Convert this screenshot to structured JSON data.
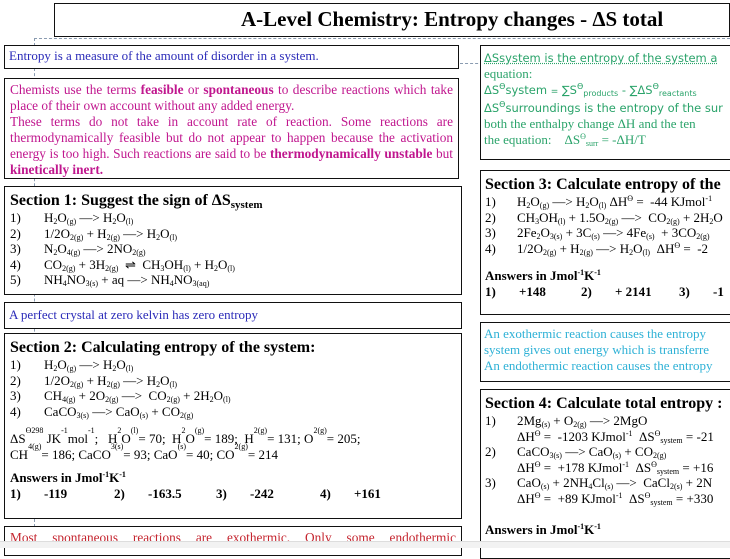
{
  "title": "A-Level Chemistry:  Entropy changes - ΔS total",
  "left": {
    "entropy_def": "Entropy is a measure of the amount of disorder in a system.",
    "feasible": {
      "p1_a": "Chemists use the terms ",
      "p1_b": "feasible",
      "p1_c": " or ",
      "p1_d": "spontaneous",
      "p1_e": " to describe reactions which take place of their own account without any added energy.",
      "p2_a": "These terms do not take in account rate of reaction.  Some reactions are thermodynamically feasible but do not appear to happen because the activation energy is too high.  Such reactions are said to be ",
      "p2_b": "thermodynamically unstable",
      "p2_c": " but ",
      "p2_d": "kinetically inert."
    },
    "section1": {
      "heading": "Section 1: Suggest the sign of ΔS",
      "heading_sub": "system",
      "items": [
        "1)",
        "2)",
        "3)",
        "4)",
        "5)"
      ]
    },
    "perfect_crystal": "A perfect crystal at zero kelvin has zero entropy",
    "section2": {
      "heading": "Section 2: Calculating entropy of the system:",
      "items": [
        "1)",
        "2)",
        "3)",
        "4)"
      ],
      "data_line1": "ΔSϴ298 JK-1mol-1;  H2O(l) = 70; H2O(g) = 189; H2(g) = 131; O2(g) = 205;",
      "data_line2": "CH4(g) = 186; CaCO3(s) = 93; CaO(s) = 40; CO2(g) = 214",
      "answers_heading": "Answers in Jmol-1K-1",
      "answers": [
        {
          "n": "1)",
          "v": "-119"
        },
        {
          "n": "2)",
          "v": "-163.5"
        },
        {
          "n": "3)",
          "v": "-242"
        },
        {
          "n": "4)",
          "v": "+161"
        }
      ]
    },
    "spontaneous_note": "Most spontaneous reactions are exothermic.  Only some endothermic"
  },
  "right": {
    "system_def": {
      "line1": "ΔSsystem is the entropy of the system a",
      "line2": "equation:",
      "line3": "ΔSϴsystem = ∑Sϴproducts - ∑ΔSϴreactants",
      "line4": "ΔSϴsurroundings is the entropy of the sur",
      "line5": "both the enthalpy change  ΔH and the ten",
      "line6": "the equation:    ΔSϴsurr = -ΔH/T"
    },
    "section3": {
      "heading": "Section 3: Calculate entropy of the",
      "items": [
        "1)",
        "2)",
        "3)",
        "4)"
      ],
      "answers_heading": "Answers in Jmol-1K-1",
      "answers": [
        {
          "n": "1)",
          "v": "+148"
        },
        {
          "n": "2)",
          "v": "+ 2141"
        },
        {
          "n": "3)",
          "v": "-1"
        }
      ]
    },
    "exo_endo": {
      "line1": "An exothermic reaction causes the entropy",
      "line2": "system gives out energy which is transferre",
      "line3": "An endothermic reaction causes the entropy"
    },
    "section4": {
      "heading": "Section 4: Calculate total entropy :",
      "items": [
        "1)",
        "2)",
        "3)"
      ],
      "answers_heading": "Answers in Jmol-1K-1"
    }
  },
  "colors": {
    "blue": "#2a2ab8",
    "magenta": "#c0168e",
    "green": "#2aa36a",
    "cyan": "#2eb1d6",
    "red": "#c4242e"
  }
}
